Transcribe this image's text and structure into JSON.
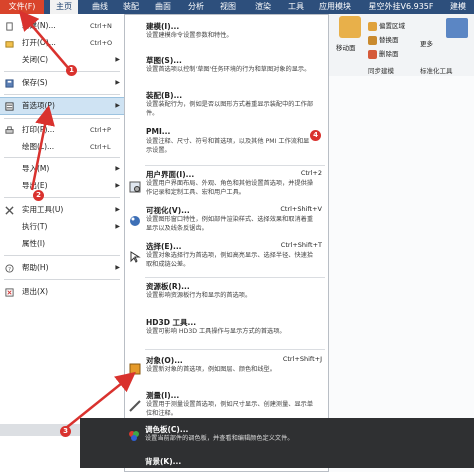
{
  "tabs": [
    "文件(F)",
    "主页",
    "曲线",
    "装配",
    "曲面",
    "分析",
    "视图",
    "渲染",
    "工具",
    "应用模块",
    "星空外挂V6.935F",
    "建模"
  ],
  "ribbon": {
    "buttons": [
      "偏置区域",
      "移动面",
      "替换面",
      "删除面",
      "更多"
    ],
    "groups": [
      "同步建模",
      "标准化工具"
    ]
  },
  "file_menu": {
    "items": [
      {
        "label": "新建(N)...",
        "shortcut": "Ctrl+N"
      },
      {
        "label": "打开(O)...",
        "shortcut": "Ctrl+O"
      },
      {
        "label": "关闭(C)",
        "shortcut": ""
      },
      {
        "label": "保存(S)",
        "shortcut": ""
      },
      {
        "label": "首选项(P)",
        "shortcut": ""
      },
      {
        "label": "打印(P)...",
        "shortcut": "Ctrl+P"
      },
      {
        "label": "绘图(L)...",
        "shortcut": "Ctrl+L"
      },
      {
        "label": "导入(M)",
        "shortcut": ""
      },
      {
        "label": "导出(E)",
        "shortcut": ""
      },
      {
        "label": "实用工具(U)",
        "shortcut": ""
      },
      {
        "label": "执行(T)",
        "shortcut": ""
      },
      {
        "label": "属性(I)",
        "shortcut": ""
      },
      {
        "label": "帮助(H)",
        "shortcut": ""
      },
      {
        "label": "退出(X)",
        "shortcut": ""
      }
    ],
    "selected": "首选项(P)"
  },
  "submenu": {
    "items": [
      {
        "title": "建模(I)...",
        "shortcut": "",
        "desc": "设置建模命令设置参数和特性。"
      },
      {
        "title": "草图(S)...",
        "shortcut": "",
        "desc": "设置首选项以控制'草图'任务环境的行为和草图对象的显示。"
      },
      {
        "title": "装配(B)...",
        "shortcut": "",
        "desc": "设置装配行为，例如是否以图形方式着重显示装配中的工作部件。"
      },
      {
        "title": "PMI...",
        "shortcut": "",
        "desc": "设置注释、尺寸、符号和首选项，以及其他 PMI 工作流和显示设置。"
      },
      {
        "title": "用户界面(I)...",
        "shortcut": "Ctrl+2",
        "desc": "设置用户界面布局、外观、角色和其他设置首选项，并提供操作记录和定制工具、宏和用户工具。"
      },
      {
        "title": "可视化(V)...",
        "shortcut": "Ctrl+Shift+V",
        "desc": "设置图形窗口特性，例如部件渲染样式、选择效果和取消着重显示以及线条反锯齿。"
      },
      {
        "title": "选择(E)...",
        "shortcut": "Ctrl+Shift+T",
        "desc": "设置对象选择行为首选项，例如高亮显示、选择半径、快速拾取和成链公差。"
      },
      {
        "title": "资源板(R)...",
        "shortcut": "",
        "desc": "设置影响资源板行为和显示的首选项。"
      },
      {
        "title": "HD3D 工具...",
        "shortcut": "",
        "desc": "设置可影响 HD3D 工具操作与显示方式的首选项。"
      },
      {
        "title": "对象(O)...",
        "shortcut": "Ctrl+Shift+J",
        "desc": "设置新对象的首选项，例如图层、颜色和线型。"
      },
      {
        "title": "测量(I)...",
        "shortcut": "",
        "desc": "设置用于测量设置首选项，例如尺寸显示、创建测量、显示单位和注释。"
      },
      {
        "title": "调色板(C)...",
        "shortcut": "",
        "desc": "设置当前部件的调色板，并查看和编辑颜色定义文件。"
      },
      {
        "title": "背景(K)...",
        "shortcut": "",
        "desc": ""
      }
    ]
  },
  "badges": [
    "1",
    "2",
    "3",
    "4"
  ],
  "colors": {
    "title_bar": "#2d4f7c",
    "file_tab": "#d9442b",
    "selected_row": "#cfe3f3",
    "arrow_red": "#d9322e"
  }
}
